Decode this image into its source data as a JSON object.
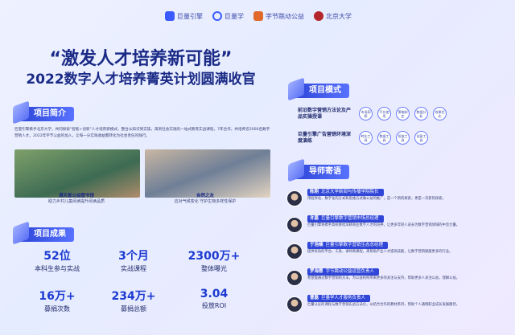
{
  "logos": [
    "巨量引擎",
    "巨量学",
    "字节跳动公益",
    "北京大学"
  ],
  "title": {
    "line1": "“激发人才培养新可能”",
    "line2": "2022数字人才培养菁英计划圆满收官"
  },
  "intro": {
    "heading": "项目简介",
    "text": "巨量引擎携手北京大学，共同探索“智能+创新”人才培育新模式，整合从知识到实操，再到社会实践的一站式教育实战课程，7年合作，共培养近2000名数字营销人才。2022年字节公益的加入，让每一分实践收益都转化为社会责任的践行。",
    "photos": [
      {
        "title": "满天星公益图书馆",
        "caption": "助力乡村儿童阅读提升阅读品质"
      },
      {
        "title": "自然之友",
        "caption": "应对气候变化 守护生物多样性保护"
      }
    ]
  },
  "results": {
    "heading": "项目成果",
    "stats": [
      {
        "value": "52位",
        "label": "本科生参与实战"
      },
      {
        "value": "3个月",
        "label": "实战课程"
      },
      {
        "value": "2300万+",
        "label": "整体曝光"
      },
      {
        "value": "16万+",
        "label": "募捐次数"
      },
      {
        "value": "234万+",
        "label": "募捐总额"
      },
      {
        "value": "3.04",
        "label": "投放ROI"
      }
    ]
  },
  "model": {
    "heading": "项目模式",
    "rows": [
      {
        "label": "前沿数字营销方法论及产品实操授课",
        "chips": [
          "市场洞察",
          "平台使用",
          "策略制定",
          "数据分析",
          "效果优化"
        ]
      },
      {
        "label": "巨量引擎广告营销环境深度演练",
        "chips": [
          "转化工具",
          "数据工具",
          "投放工具",
          "创意工具"
        ]
      }
    ]
  },
  "mentors": {
    "heading": "导师寄语",
    "items": [
      {
        "name": "陈刚",
        "title": "北京大学新闻与传播学院院长",
        "quote": "用程序化、数字化的方式和思维方式做公益的推广，是一个新的探索，更是一次新的探索。"
      },
      {
        "name": "许嘉",
        "title": "巨量引擎数字营销市场总经理",
        "quote": "巨量引擎将携手高校继续深耕商业数字人才的培养，让更多年轻人成长为数字营销领域的中坚力量。"
      },
      {
        "name": "于浩楠",
        "title": "巨量引擎数字营销生态总经理",
        "quote": "提供有效的平台、工具、讲师和课程，来帮助产业人才提高技能，让数字营销赋能更多的行业。"
      },
      {
        "name": "罗海蓉",
        "title": "字节跳动公益运营负责人",
        "quote": "希望能通过数字营销的方法，为公益机构带来更多的关注与支持，帮助更多人关注公益，理解公益。"
      },
      {
        "name": "曹磊",
        "title": "巨量学人才服务负责人",
        "quote": "巨量认证的课程与数字营销实战方法论，以结合合作的教材系列，帮助个人通晓职业成长发展路径。"
      }
    ]
  }
}
